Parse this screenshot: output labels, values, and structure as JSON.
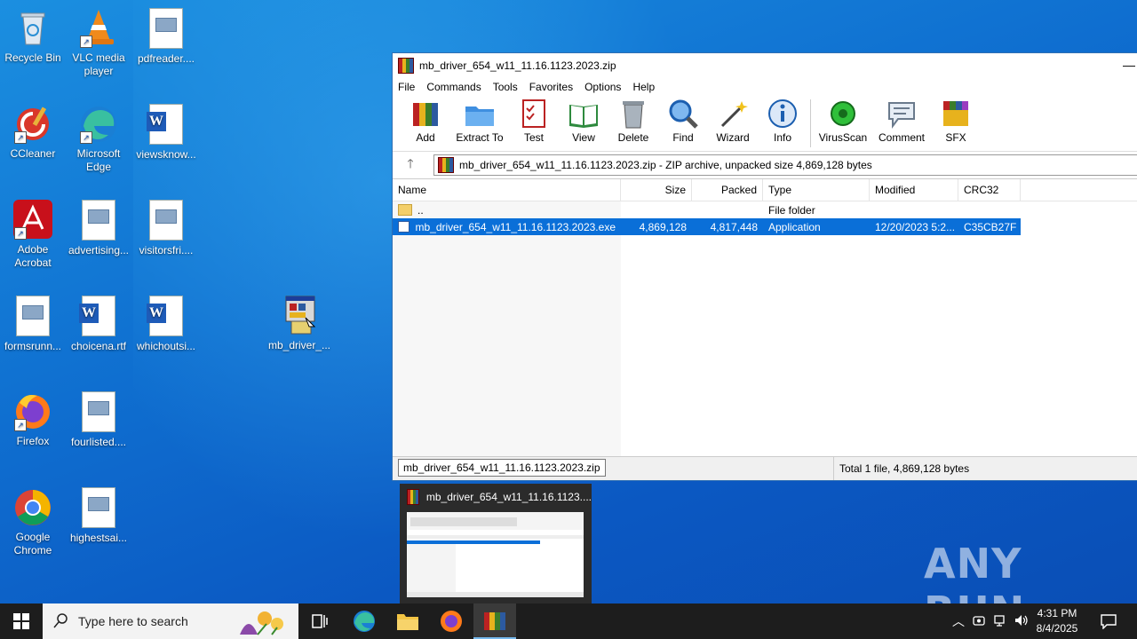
{
  "desktop": {
    "icons": [
      {
        "label": "Recycle Bin"
      },
      {
        "label": "VLC media player"
      },
      {
        "label": "pdfreader...."
      },
      {
        "label": "CCleaner"
      },
      {
        "label": "Microsoft Edge"
      },
      {
        "label": "viewsknow..."
      },
      {
        "label": "Adobe Acrobat"
      },
      {
        "label": "advertising..."
      },
      {
        "label": "visitorsfri...."
      },
      {
        "label": "formsrunn..."
      },
      {
        "label": "choicena.rtf"
      },
      {
        "label": "whichoutsi..."
      },
      {
        "label": "mb_driver_..."
      },
      {
        "label": "Firefox"
      },
      {
        "label": "fourlisted...."
      },
      {
        "label": "Google Chrome"
      },
      {
        "label": "highestsai..."
      }
    ]
  },
  "window": {
    "title": "mb_driver_654_w11_11.16.1123.2023.zip",
    "minimize": "—",
    "menu": [
      "File",
      "Commands",
      "Tools",
      "Favorites",
      "Options",
      "Help"
    ],
    "toolbar": [
      "Add",
      "Extract To",
      "Test",
      "View",
      "Delete",
      "Find",
      "Wizard",
      "Info",
      "VirusScan",
      "Comment",
      "SFX"
    ],
    "up_arrow": "🡑",
    "address": "mb_driver_654_w11_11.16.1123.2023.zip - ZIP archive, unpacked size 4,869,128 bytes",
    "columns": {
      "name": "Name",
      "size": "Size",
      "packed": "Packed",
      "type": "Type",
      "modified": "Modified",
      "crc": "CRC32"
    },
    "rows": [
      {
        "name": "..",
        "size": "",
        "packed": "",
        "type": "File folder",
        "modified": "",
        "crc": ""
      },
      {
        "name": "mb_driver_654_w11_11.16.1123.2023.exe",
        "size": "4,869,128",
        "packed": "4,817,448",
        "type": "Application",
        "modified": "12/20/2023 5:2...",
        "crc": "C35CB27F"
      }
    ],
    "status_tooltip": "mb_driver_654_w11_11.16.1123.2023.zip",
    "status_total": "Total 1 file, 4,869,128 bytes"
  },
  "preview": {
    "title": "mb_driver_654_w11_11.16.1123...."
  },
  "watermark": "ANY RUN",
  "taskbar": {
    "search_placeholder": "Type here to search",
    "time": "4:31 PM",
    "date": "8/4/2025"
  },
  "colors": {
    "selection": "#0a6fd8",
    "taskbar": "#1d1d1d",
    "desktop": "#0f6fd0"
  }
}
